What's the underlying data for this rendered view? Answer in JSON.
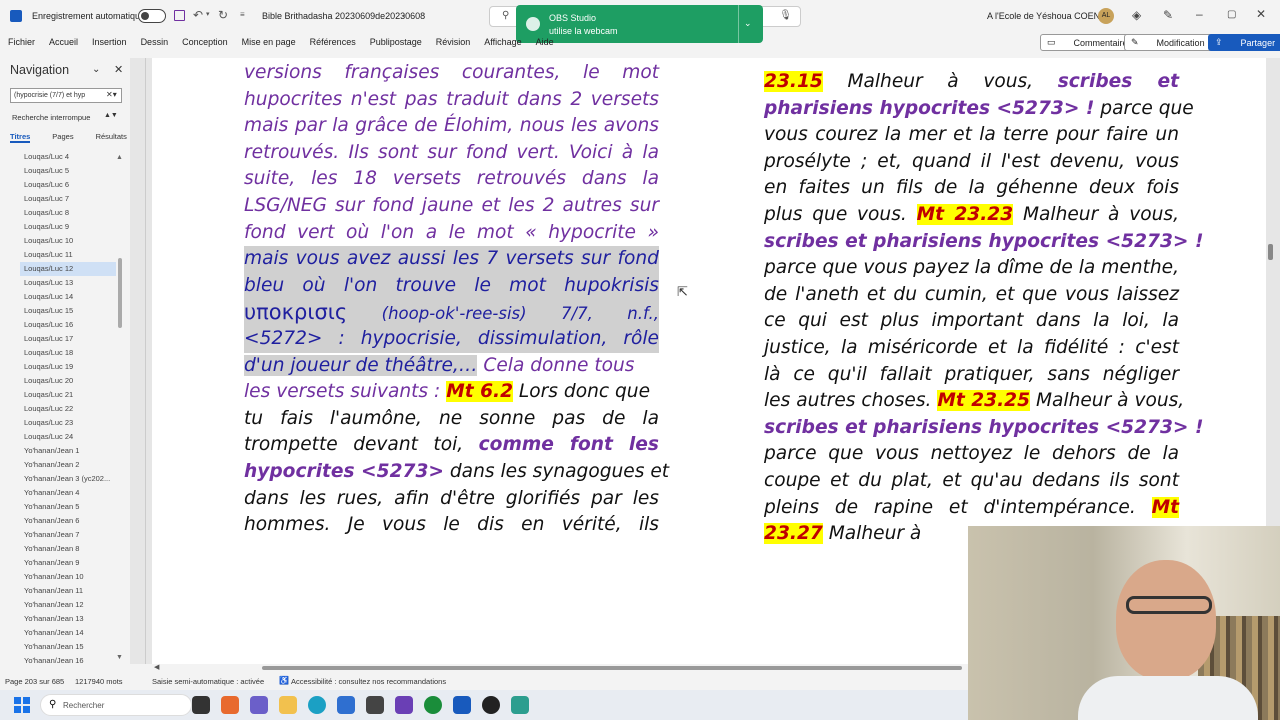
{
  "titlebar": {
    "autosave_label": "Enregistrement automatique",
    "doc_title": "Bible Brithadasha 20230609de20230608",
    "search_placeholder": "",
    "account": "A l'Ecole de Yéshoua COENNE",
    "avatar_initials": "AL"
  },
  "notification": {
    "title": "OBS Studio",
    "message": "utilise la webcam"
  },
  "menu": {
    "items": [
      "Fichier",
      "Accueil",
      "Insertion",
      "Dessin",
      "Conception",
      "Mise en page",
      "Références",
      "Publipostage",
      "Révision",
      "Affichage",
      "Aide"
    ],
    "comments": "Commentaires",
    "editing": "Modification",
    "share": "Partager"
  },
  "navigation": {
    "title": "Navigation",
    "search_value": "(hypocrisie (7/7) et hyp",
    "interrupted": "Recherche interrompue",
    "tabs": [
      "Titres",
      "Pages",
      "Résultats"
    ],
    "items": [
      "Louqas/Luc 4",
      "Louqas/Luc 5",
      "Louqas/Luc 6",
      "Louqas/Luc 7",
      "Louqas/Luc 8",
      "Louqas/Luc 9",
      "Louqas/Luc 10",
      "Louqas/Luc 11",
      "Louqas/Luc 12",
      "Louqas/Luc 13",
      "Louqas/Luc 14",
      "Louqas/Luc 15",
      "Louqas/Luc 16",
      "Louqas/Luc 17",
      "Louqas/Luc 18",
      "Louqas/Luc 19",
      "Louqas/Luc 20",
      "Louqas/Luc 21",
      "Louqas/Luc 22",
      "Louqas/Luc 23",
      "Louqas/Luc 24",
      "Yo'hanan/Jean 1",
      "Yo'hanan/Jean 2",
      "Yo'hanan/Jean 3 (yc202...",
      "Yo'hanan/Jean 4",
      "Yo'hanan/Jean 5",
      "Yo'hanan/Jean 6",
      "Yo'hanan/Jean 7",
      "Yo'hanan/Jean 8",
      "Yo'hanan/Jean 9",
      "Yo'hanan/Jean 10",
      "Yo'hanan/Jean 11",
      "Yo'hanan/Jean 12",
      "Yo'hanan/Jean 13",
      "Yo'hanan/Jean 14",
      "Yo'hanan/Jean 15",
      "Yo'hanan/Jean 16"
    ],
    "selected": "Louqas/Luc 12"
  },
  "doc": {
    "left": {
      "l1": "versions françaises courantes, le mot",
      "l2": "hupocrites n'est pas traduit dans 2 versets",
      "l3": "mais par la grâce de Élohim, nous les avons",
      "l4": "retrouvés. Ils sont sur fond vert. Voici à la",
      "l5": "suite, les 18 versets retrouvés dans la",
      "l6": "LSG/NEG sur fond jaune et les 2 autres sur",
      "l7": "fond vert où l'on a le mot « hypocrite »",
      "l8": "mais vous avez aussi les 7 versets sur fond",
      "l9": "bleu où l'on trouve le mot hupokrisis",
      "l10a": "υποκρισις",
      "l10b": " (hoop-ok'-ree-sis) 7/7, n.f.,",
      "l11": "<5272> : hypocrisie, dissimulation, rôle",
      "l12a": "d'un joueur de théâtre,…",
      "l12b": " Cela donne tous",
      "l13a": "les versets suivants  : ",
      "l13ref": "Mt 6.2",
      "l13c": " Lors donc que",
      "l14": "tu fais l'aumône, ne sonne pas de la",
      "l15a": "trompette devant toi, ",
      "l15b": "comme font les",
      "l16a": "hypocrites <5273>",
      "l16b": " dans les synagogues et",
      "l17": "dans les rues, afin d'être glorifiés par les",
      "l18": "hommes. Je vous le dis en vérité, ils"
    },
    "right": {
      "r1ref": "23.15",
      "r1a": " Malheur à vous, ",
      "r1b": "scribes et",
      "r2a": "pharisiens hypocrites <5273> !",
      "r2b": " parce que",
      "r3": "vous courez la mer et la terre pour faire un",
      "r4": "prosélyte ; et, quand il l'est devenu, vous",
      "r5": "en faites un fils de la géhenne deux fois",
      "r6a": "plus que vous. ",
      "r6ref": "Mt 23.23",
      "r6b": " Malheur à vous,",
      "r7": "scribes et pharisiens hypocrites <5273> !",
      "r8": "parce que vous payez la dîme de la menthe,",
      "r9": "de l'aneth et du cumin, et que vous laissez",
      "r10": "ce qui est plus important dans la loi, la",
      "r11": "justice, la miséricorde et la fidélité : c'est",
      "r12": "là ce qu'il fallait pratiquer, sans négliger",
      "r13a": "les autres choses. ",
      "r13ref": "Mt 23.25",
      "r13b": " Malheur à vous,",
      "r14": "scribes et pharisiens hypocrites <5273> !",
      "r15": "parce que vous nettoyez le dehors de la",
      "r16": "coupe et du plat, et qu'au dedans ils sont",
      "r17a": "pleins de rapine et d'intempérance. ",
      "r17ref": "Mt",
      "r18ref": "23.27",
      "r18a": " Malheur à"
    }
  },
  "status": {
    "page": "Page 203 sur 685",
    "words": "1217940 mots",
    "input_mode": "Saisie semi-automatique : activée",
    "accessibility": "Accessibilité : consultez nos recommandations"
  },
  "taskbar": {
    "search_placeholder": "Rechercher"
  },
  "colors": {
    "accent": "#185abd",
    "purple_text": "#7030a0",
    "blue_text": "#1f1f9f",
    "highlight_yellow": "#ffff00",
    "ref_red": "#c00000",
    "notification_green": "#1e9e63"
  }
}
